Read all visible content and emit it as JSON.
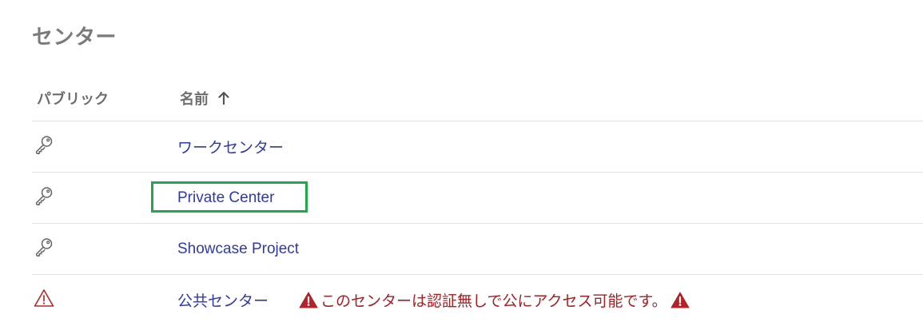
{
  "page": {
    "title": "センター"
  },
  "table": {
    "headers": {
      "public": "パブリック",
      "name": "名前"
    },
    "sort": {
      "column": "name",
      "direction": "ascending",
      "icon": "arrow-up-icon"
    },
    "rows": [
      {
        "icon": "key-icon",
        "name": "ワークセンター"
      },
      {
        "icon": "key-icon",
        "name": "Private Center"
      },
      {
        "icon": "key-icon",
        "name": "Showcase Project"
      },
      {
        "icon": "warning-triangle-icon",
        "name": "公共センター",
        "warning": "このセンターは認証無しで公にアクセス可能です。"
      }
    ]
  },
  "colors": {
    "link": "#2f3aa8",
    "warning": "#a32024",
    "highlight_border": "#22a84a",
    "header_text": "#6e6e6e"
  }
}
